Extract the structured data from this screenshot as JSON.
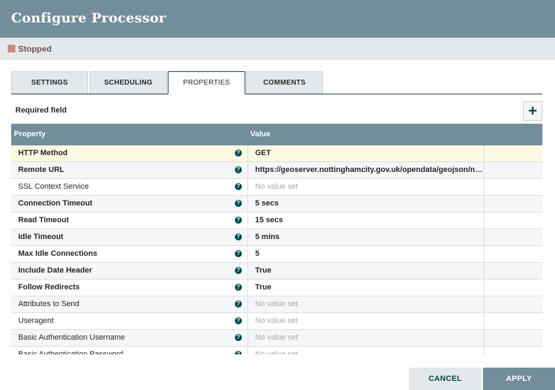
{
  "dialog": {
    "title": "Configure Processor",
    "status": "Stopped",
    "status_color": "#d18686"
  },
  "tabs": [
    {
      "label": "SETTINGS"
    },
    {
      "label": "SCHEDULING"
    },
    {
      "label": "PROPERTIES"
    },
    {
      "label": "COMMENTS"
    }
  ],
  "active_tab": "PROPERTIES",
  "properties": {
    "required_label": "Required field",
    "add_icon": "plus-icon",
    "columns": {
      "property": "Property",
      "value": "Value"
    },
    "rows": [
      {
        "name": "HTTP Method",
        "value": "GET",
        "required": true,
        "help": "?"
      },
      {
        "name": "Remote URL",
        "value": "https://geoserver.nottinghamcity.gov.uk/opendata/geojson/ncc_Corporate_Wi-Fi_Network.json",
        "required": true,
        "help": "?"
      },
      {
        "name": "SSL Context Service",
        "value": "No value set",
        "required": false,
        "help": "?"
      },
      {
        "name": "Connection Timeout",
        "value": "5 secs",
        "required": true,
        "help": "?"
      },
      {
        "name": "Read Timeout",
        "value": "15 secs",
        "required": true,
        "help": "?"
      },
      {
        "name": "Idle Timeout",
        "value": "5 mins",
        "required": true,
        "help": "?"
      },
      {
        "name": "Max Idle Connections",
        "value": "5",
        "required": true,
        "help": "?"
      },
      {
        "name": "Include Date Header",
        "value": "True",
        "required": true,
        "help": "?"
      },
      {
        "name": "Follow Redirects",
        "value": "True",
        "required": true,
        "help": "?"
      },
      {
        "name": "Attributes to Send",
        "value": "No value set",
        "required": false,
        "help": "?"
      },
      {
        "name": "Useragent",
        "value": "No value set",
        "required": false,
        "help": "?"
      },
      {
        "name": "Basic Authentication Username",
        "value": "No value set",
        "required": false,
        "help": "?"
      },
      {
        "name": "Basic Authentication Password",
        "value": "No value set",
        "required": false,
        "help": "?"
      }
    ]
  },
  "footer": {
    "cancel_label": "CANCEL",
    "apply_label": "APPLY"
  },
  "colors": {
    "header": "#728e9b",
    "accent": "#004849",
    "selected_row": "#fcf9e2"
  }
}
